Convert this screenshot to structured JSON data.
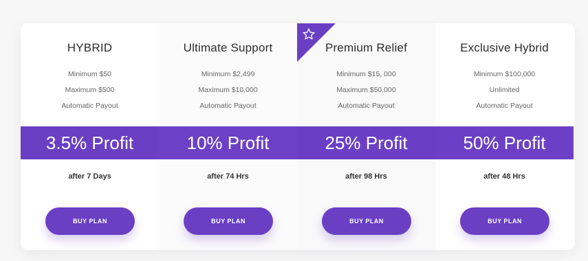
{
  "plans": [
    {
      "title": "HYBRID",
      "minimum": "Minimum $50",
      "maximum": "Maximum $500",
      "payout": "Automatic Payout",
      "profit": "3.5% Profit",
      "after": "after 7 Days",
      "button": "BUY PLAN"
    },
    {
      "title": "Ultimate Support",
      "minimum": "Minimum $2,499",
      "maximum": "Maximum $10,000",
      "payout": "Automatic Payout",
      "profit": "10% Profit",
      "after": "after 74 Hrs",
      "button": "BUY PLAN"
    },
    {
      "title": "Premium Relief",
      "minimum": "Minimum $15, 000",
      "maximum": "Maximum $50,000",
      "payout": "Automatic Payout",
      "profit": "25% Profit",
      "after": "after 98 Hrs",
      "button": "BUY PLAN"
    },
    {
      "title": "Exclusive Hybrid",
      "minimum": "Minimum $100,000",
      "maximum": "Unlimited",
      "payout": "Automatic Payout",
      "profit": "50% Profit",
      "after": "after 48 Hrs",
      "button": "BUY PLAN"
    }
  ],
  "featured_ribbon": {
    "icon": "star-outline-icon",
    "color": "#6a3fc4"
  },
  "colors": {
    "accent": "#6a3fc4",
    "background": "#f7f7f8",
    "card": "#ffffff"
  }
}
